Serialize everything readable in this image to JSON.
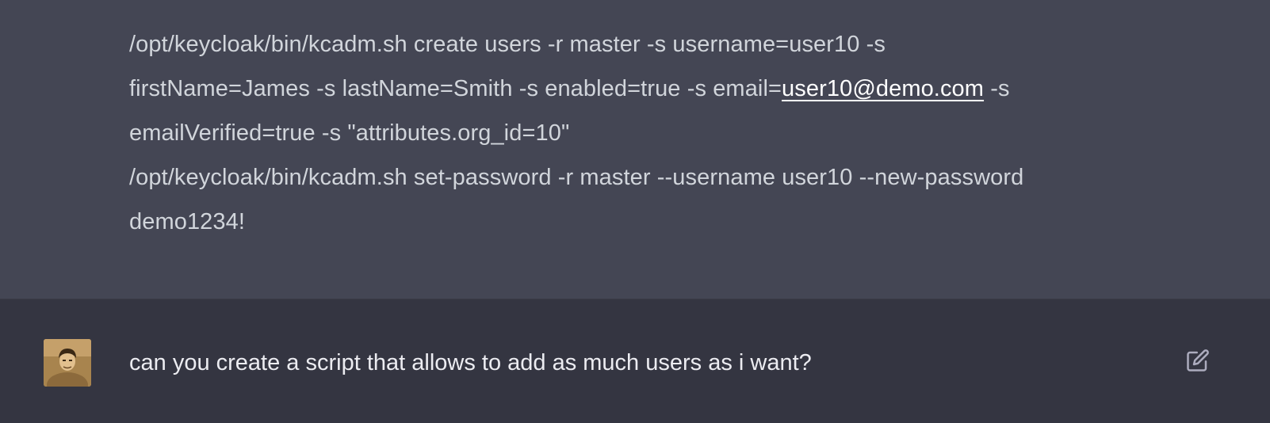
{
  "assistant_message": {
    "lines": [
      "/opt/keycloak/bin/kcadm.sh create users -r master -s username=user10 -s",
      "firstName=James -s lastName=Smith -s enabled=true -s email=",
      "emailVerified=true -s \"attributes.org_id=10\"",
      "/opt/keycloak/bin/kcadm.sh set-password -r master --username user10 --new-password",
      "demo1234!"
    ],
    "email_link": "user10@demo.com",
    "line2_suffix": " -s"
  },
  "user_message": {
    "text": "can you create a script that allows to add as much users as i want?",
    "avatar_icon": "user-avatar",
    "edit_icon": "edit-icon"
  },
  "colors": {
    "assistant_bg": "#444654",
    "user_bg": "#343541",
    "text": "#d1d5db",
    "link": "#ffffff"
  }
}
